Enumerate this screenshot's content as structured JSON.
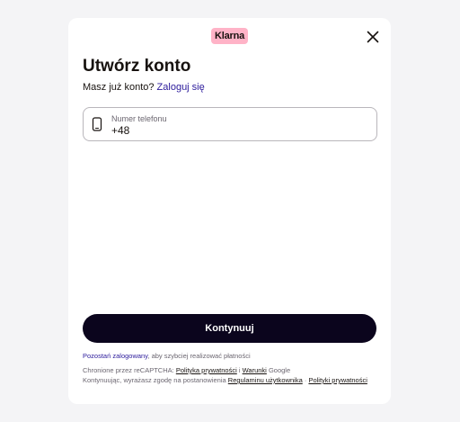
{
  "brand": {
    "logo_text": "Klarna",
    "logo_bg": "#ffb3c7",
    "accent": "#0b051d",
    "link_color": "#2b1a9b"
  },
  "header": {
    "close_icon": "close-icon"
  },
  "main": {
    "title": "Utwórz konto",
    "signin_prompt": "Masz już konto?",
    "signin_link": "Zaloguj się",
    "phone": {
      "label": "Numer telefonu",
      "value": "+48",
      "icon": "phone-icon"
    }
  },
  "footer": {
    "continue_label": "Kontynuuj",
    "stay_link": "Pozostań zalogowany",
    "stay_rest": ", aby szybciej realizować płatności",
    "recaptcha_prefix": "Chronione przez reCAPTCHA:",
    "privacy_policy": "Polityka prywatności",
    "and": "i",
    "terms": "Warunki",
    "google": "Google",
    "consent_prefix": "Kontynuując, wyrażasz zgodę na postanowienia",
    "user_terms": "Regulaminu użytkownika",
    "sep": "·",
    "privacy_policies": "Polityki prywatności"
  }
}
